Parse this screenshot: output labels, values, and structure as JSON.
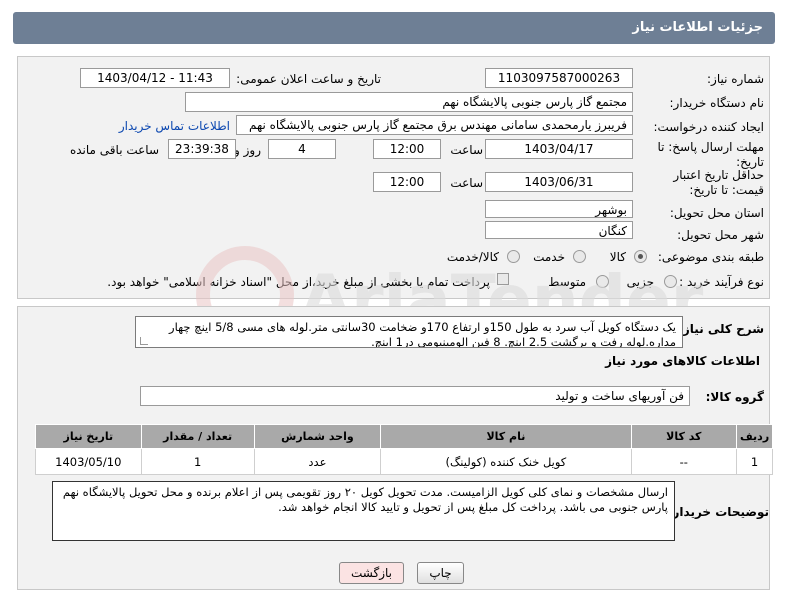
{
  "header": {
    "title": "جزئیات اطلاعات نیاز"
  },
  "form": {
    "need_number": {
      "label": "شماره نیاز:",
      "value": "1103097587000263"
    },
    "announce_datetime": {
      "label": "تاریخ و ساعت اعلان عمومی:",
      "value": "1403/04/12 - 11:43"
    },
    "buyer_org": {
      "label": "نام دستگاه خریدار:",
      "value": "مجتمع گاز پارس جنوبی  پالایشگاه نهم"
    },
    "requester": {
      "label": "ایجاد کننده درخواست:",
      "value": "فریبرز یارمحمدی سامانی مهندس برق مجتمع گاز پارس جنوبی  پالایشگاه نهم",
      "contact_link": "اطلاعات تماس خریدار"
    },
    "reply_deadline": {
      "label": "مهلت ارسال پاسخ: تا تاریخ:",
      "date": "1403/04/17",
      "time_label": "ساعت",
      "time": "12:00",
      "days": "4",
      "days_label": "روز و",
      "remaining": "23:39:38",
      "remaining_label": "ساعت باقی مانده"
    },
    "price_validity": {
      "label": "حداقل تاریخ اعتبار قیمت: تا تاریخ:",
      "date": "1403/06/31",
      "time_label": "ساعت",
      "time": "12:00"
    },
    "province": {
      "label": "استان محل تحویل:",
      "value": "بوشهر"
    },
    "city": {
      "label": "شهر محل تحویل:",
      "value": "کنگان"
    },
    "category": {
      "label": "طبقه بندی موضوعی:",
      "options": [
        "کالا",
        "خدمت",
        "کالا/خدمت"
      ],
      "selected": "کالا"
    },
    "purchase_type": {
      "label": "نوع فرآیند خرید :",
      "options": [
        "جزیی",
        "متوسط"
      ],
      "note": "پرداخت تمام یا بخشی از مبلغ خرید،از محل \"اسناد خزانه اسلامی\" خواهد بود."
    },
    "general_description": {
      "label": "شرح کلی نیاز:",
      "text": "یک دستگاه کویل آب سرد به طول 150و ارتفاع 170و ضخامت 30سانتی متر.لوله های مسی 5/8 اینچ چهار مداره.لوله رفت و برگشت 2.5 اینچ. 8 فین الومینیومی در1 اینچ."
    },
    "goods_info_title": "اطلاعات کالاهای مورد نیاز",
    "goods_group": {
      "label": "گروه کالا:",
      "value": "فن آوریهای ساخت و تولید"
    },
    "buyer_notes": {
      "label": "توضیحات خریدار:",
      "text": "ارسال مشخصات و نمای کلی کویل الزامیست. مدت تحویل کویل ۲۰ روز تقویمی پس از اعلام برنده و محل تحویل پالایشگاه نهم پارس جنوبی می باشد. پرداخت کل مبلغ پس از تحویل و تایید کالا انجام خواهد شد."
    }
  },
  "table": {
    "headers": [
      "ردیف",
      "کد کالا",
      "نام کالا",
      "واحد شمارش",
      "تعداد / مقدار",
      "تاریخ نیاز"
    ],
    "rows": [
      [
        "1",
        "--",
        "کویل خنک کننده (کولینگ)",
        "عدد",
        "1",
        "1403/05/10"
      ]
    ]
  },
  "buttons": {
    "print": "چاپ",
    "back": "بازگشت"
  },
  "watermark": {
    "text": "AriaTender.neT"
  },
  "colors": {
    "header_bg": "#6e7f95",
    "table_header_bg": "#a9a9a9",
    "link": "#0b47b0",
    "back_button_bg": "#fbe3e3"
  }
}
